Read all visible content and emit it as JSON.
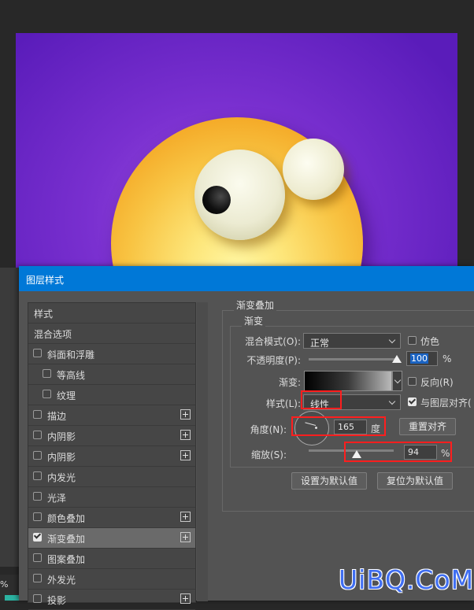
{
  "dialog": {
    "title": "图层样式"
  },
  "style_list": [
    {
      "label": "样式",
      "checkbox": false,
      "checked": false,
      "plus": false,
      "indent": false
    },
    {
      "label": "混合选项",
      "checkbox": false,
      "checked": false,
      "plus": false,
      "indent": false
    },
    {
      "label": "斜面和浮雕",
      "checkbox": true,
      "checked": false,
      "plus": false,
      "indent": false
    },
    {
      "label": "等高线",
      "checkbox": true,
      "checked": false,
      "plus": false,
      "indent": true
    },
    {
      "label": "纹理",
      "checkbox": true,
      "checked": false,
      "plus": false,
      "indent": true
    },
    {
      "label": "描边",
      "checkbox": true,
      "checked": false,
      "plus": true,
      "indent": false
    },
    {
      "label": "内阴影",
      "checkbox": true,
      "checked": false,
      "plus": true,
      "indent": false
    },
    {
      "label": "内阴影",
      "checkbox": true,
      "checked": false,
      "plus": true,
      "indent": false
    },
    {
      "label": "内发光",
      "checkbox": true,
      "checked": false,
      "plus": false,
      "indent": false
    },
    {
      "label": "光泽",
      "checkbox": true,
      "checked": false,
      "plus": false,
      "indent": false
    },
    {
      "label": "颜色叠加",
      "checkbox": true,
      "checked": false,
      "plus": true,
      "indent": false
    },
    {
      "label": "渐变叠加",
      "checkbox": true,
      "checked": true,
      "plus": true,
      "indent": false,
      "selected": true
    },
    {
      "label": "图案叠加",
      "checkbox": true,
      "checked": false,
      "plus": false,
      "indent": false
    },
    {
      "label": "外发光",
      "checkbox": true,
      "checked": false,
      "plus": false,
      "indent": false
    },
    {
      "label": "投影",
      "checkbox": true,
      "checked": false,
      "plus": true,
      "indent": false
    }
  ],
  "panel": {
    "section_title": "渐变叠加",
    "group_title": "渐变",
    "blend_mode_label": "混合模式(O):",
    "blend_mode_value": "正常",
    "dither_label": "仿色",
    "opacity_label": "不透明度(P):",
    "opacity_value": "100",
    "opacity_fraction": 1.0,
    "percent": "%",
    "gradient_label": "渐变:",
    "reverse_label": "反向(R)",
    "style_label": "样式(L):",
    "style_value": "线性",
    "align_label": "与图层对齐(",
    "angle_label": "角度(N):",
    "angle_value": "165",
    "angle_unit": "度",
    "reset_align_button": "重置对齐",
    "scale_label": "缩放(S):",
    "scale_value": "94",
    "set_default_button": "设置为默认值",
    "reset_default_button": "复位为默认值"
  },
  "status": {
    "zoom_text": "%"
  },
  "watermark": "UiBQ.CoM",
  "colors": {
    "canvas_bg": "#7a30d0",
    "face": "#f8c443",
    "titlebar": "#0078d7",
    "highlight": "#ff1e1e",
    "watermark": "#3f6ef2"
  }
}
